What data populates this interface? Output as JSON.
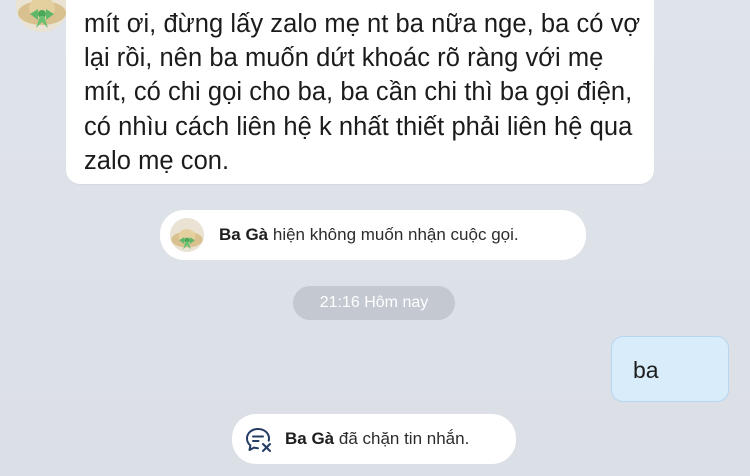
{
  "conversation": {
    "incoming_message": {
      "sender_avatar": "straw-hat-avatar",
      "text": "mít ơi, đừng lấy zalo mẹ nt ba nữa nge, ba có vợ lại rồi, nên ba muốn dứt khoác rõ ràng với mẹ mít, có chi gọi cho ba, ba cần chi thì ba gọi điện, có nhìu cách liên hệ k nhất thiết phải liên hệ qua zalo mẹ con."
    },
    "call_notice": {
      "name": "Ba Gà",
      "text": " hiện không muốn nhận cuộc gọi."
    },
    "time_divider": "21:16 Hôm nay",
    "outgoing_message": {
      "text": "ba"
    },
    "block_notice": {
      "icon": "blocked-chat-icon",
      "name": "Ba Gà",
      "text": " đã chặn tin nhắn."
    }
  },
  "colors": {
    "background": "#dde1e8",
    "incoming_bubble": "#ffffff",
    "outgoing_bubble": "#d9ecfa",
    "time_pill": "#c3c8d1"
  }
}
